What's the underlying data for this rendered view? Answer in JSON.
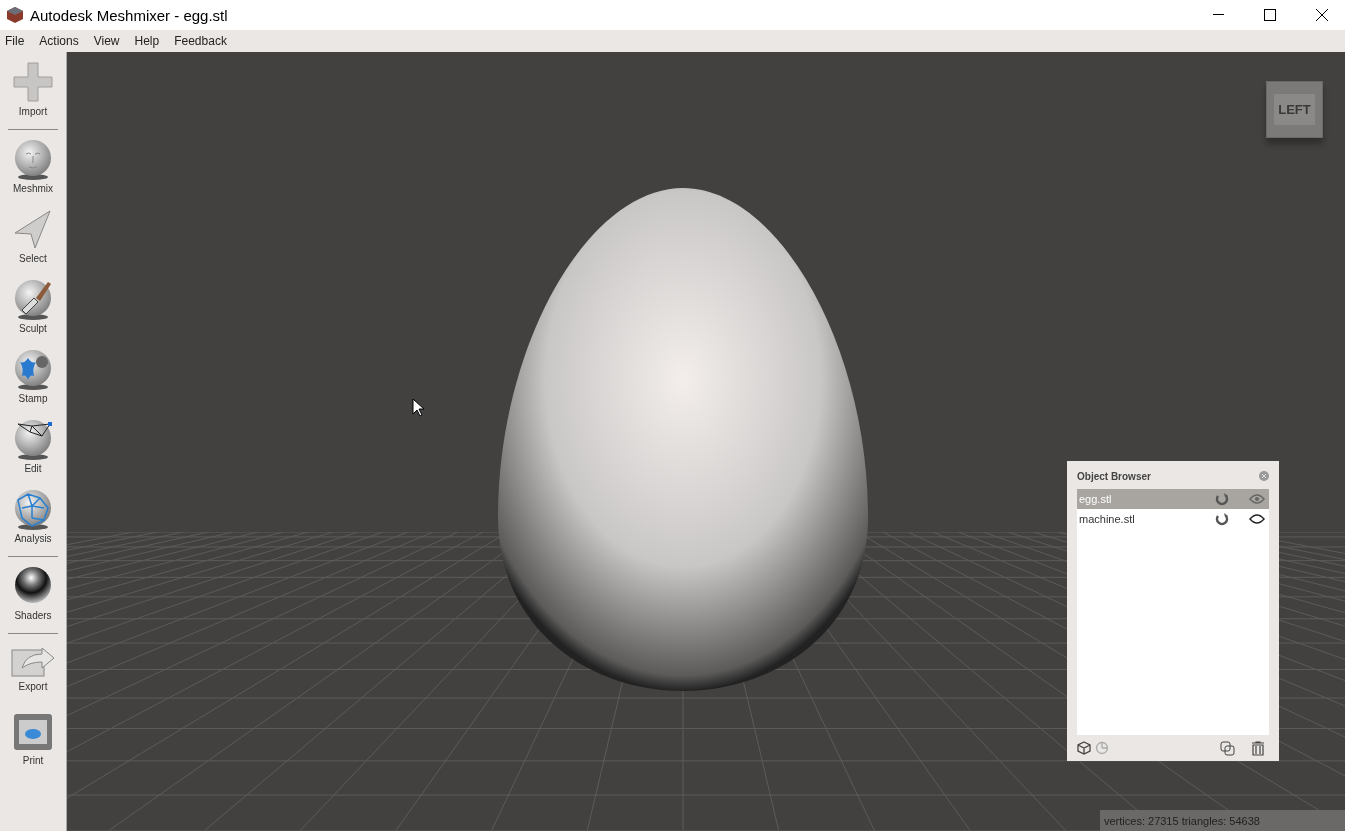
{
  "window": {
    "title": "Autodesk Meshmixer - egg.stl"
  },
  "menu": [
    "File",
    "Actions",
    "View",
    "Help",
    "Feedback"
  ],
  "tools": [
    {
      "label": "Import",
      "kind": "plus",
      "divider_after": true
    },
    {
      "label": "Meshmix",
      "kind": "ball",
      "divider_after": false
    },
    {
      "label": "Select",
      "kind": "arrow",
      "divider_after": false
    },
    {
      "label": "Sculpt",
      "kind": "brush",
      "divider_after": false
    },
    {
      "label": "Stamp",
      "kind": "stamp",
      "divider_after": false
    },
    {
      "label": "Edit",
      "kind": "edit",
      "divider_after": false
    },
    {
      "label": "Analysis",
      "kind": "mesh",
      "divider_after": true
    },
    {
      "label": "Shaders",
      "kind": "chrome",
      "divider_after": true
    },
    {
      "label": "Export",
      "kind": "export",
      "divider_after": false
    },
    {
      "label": "Print",
      "kind": "printer",
      "divider_after": false
    }
  ],
  "view_cube": {
    "label": "LEFT"
  },
  "object_browser": {
    "title": "Object Browser",
    "objects": [
      {
        "name": "egg.stl",
        "selected": true,
        "visible": true
      },
      {
        "name": "machine.stl",
        "selected": false,
        "visible": false
      }
    ]
  },
  "status_bar": "vertices: 27315 triangles: 54638"
}
